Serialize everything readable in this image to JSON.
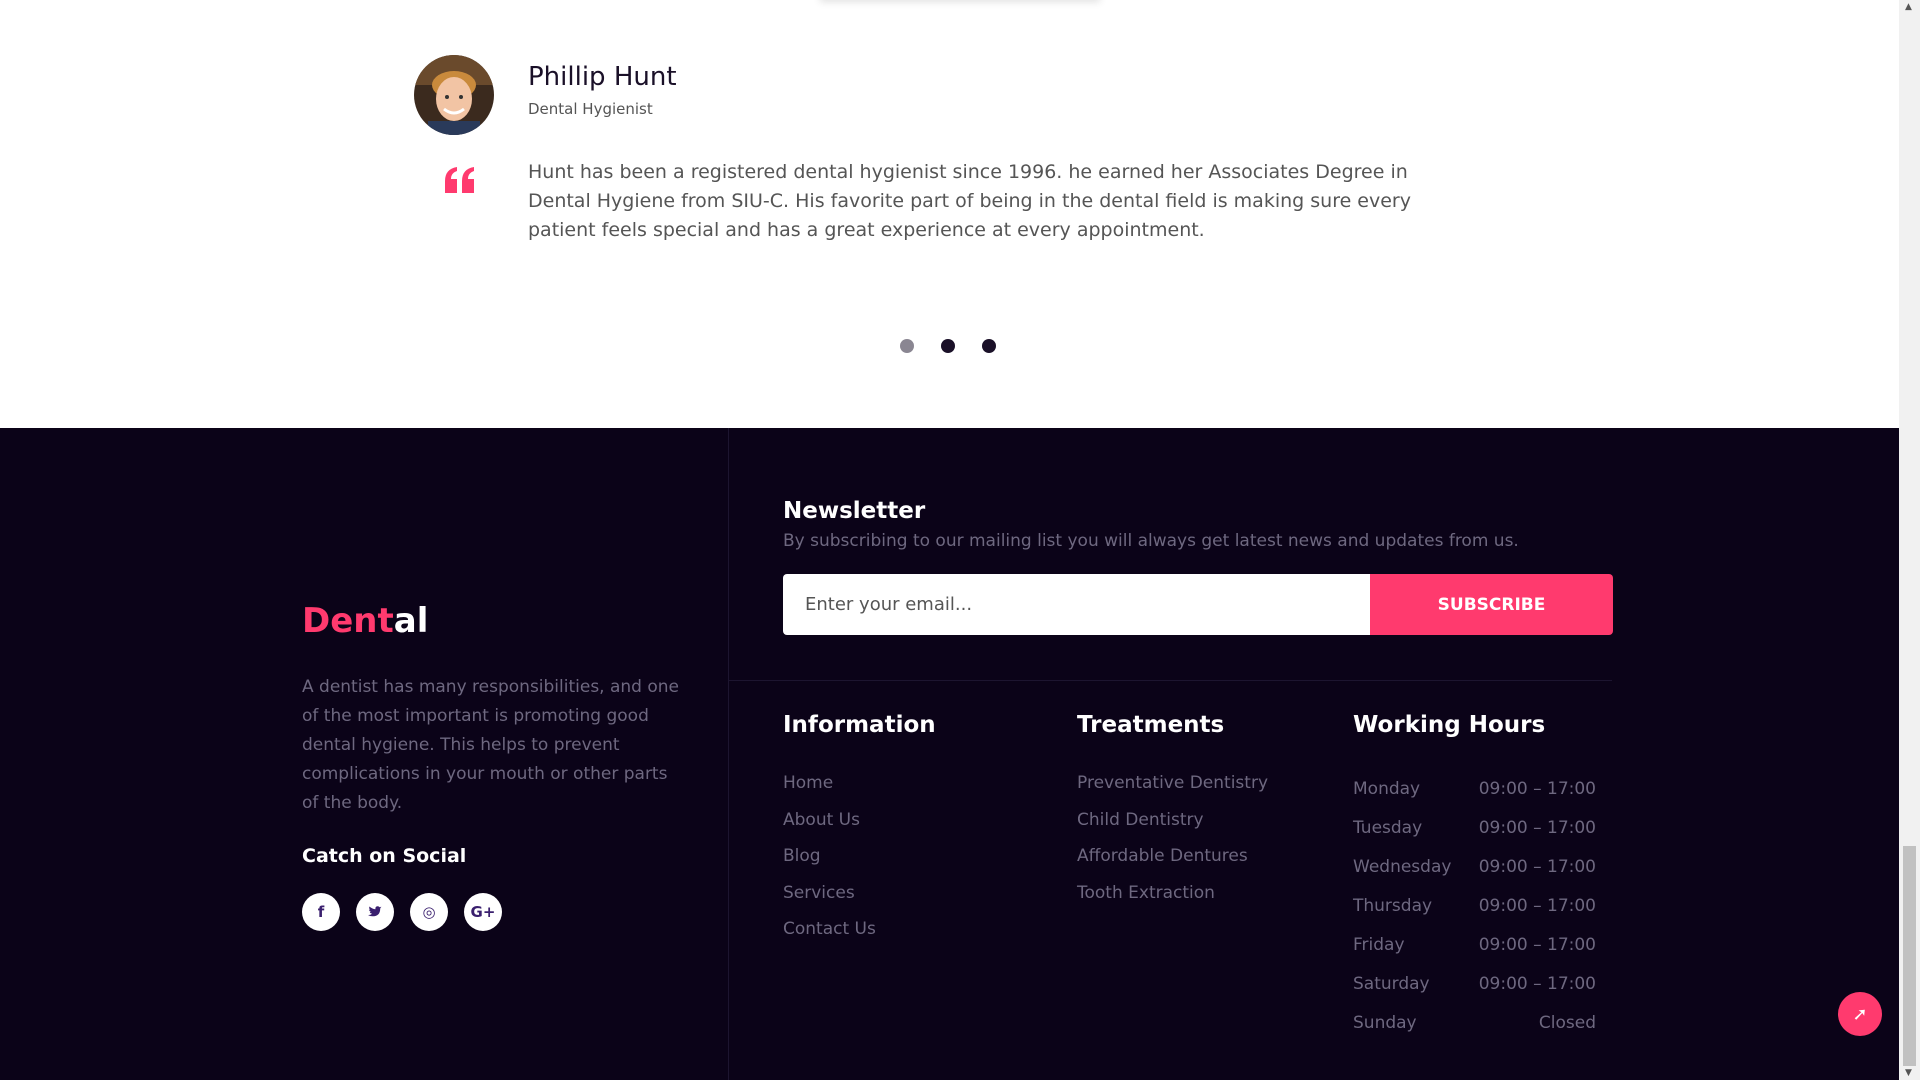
{
  "testimonial": {
    "name": "Phillip Hunt",
    "role": "Dental Hygienist",
    "quote": "Hunt has been a registered dental hygienist since 1996. he earned her Associates Degree in Dental Hygiene from SIU-C. His favorite part of being in the dental field is making sure every patient feels special and has a great experience at every appointment.",
    "active_slide": 1,
    "slide_count": 3
  },
  "footer": {
    "logo_part1": "Dent",
    "logo_part2": "al",
    "about": "A dentist has many responsibilities, and one of the most important is promoting good dental hygiene. This helps to prevent complications in your mouth or other parts of the body.",
    "social_title": "Catch on Social",
    "socials": [
      {
        "icon": "facebook-icon",
        "glyph": "f"
      },
      {
        "icon": "twitter-icon",
        "glyph": "t"
      },
      {
        "icon": "dribbble-icon",
        "glyph": "◎"
      },
      {
        "icon": "google-plus-icon",
        "glyph": "G+"
      }
    ],
    "newsletter": {
      "title": "Newsletter",
      "description": "By subscribing to our mailing list you will always get latest news and updates from us.",
      "placeholder": "Enter your email...",
      "button": "SUBSCRIBE"
    },
    "information": {
      "title": "Information",
      "links": [
        "Home",
        "About Us",
        "Blog",
        "Services",
        "Contact Us"
      ]
    },
    "treatments": {
      "title": "Treatments",
      "links": [
        "Preventative Dentistry",
        "Child Dentistry",
        "Affordable Dentures",
        "Tooth Extraction"
      ]
    },
    "hours": {
      "title": "Working Hours",
      "rows": [
        {
          "day": "Monday",
          "time": "09:00 – 17:00"
        },
        {
          "day": "Tuesday",
          "time": "09:00 – 17:00"
        },
        {
          "day": "Wednesday",
          "time": "09:00 – 17:00"
        },
        {
          "day": "Thursday",
          "time": "09:00 – 17:00"
        },
        {
          "day": "Friday",
          "time": "09:00 – 17:00"
        },
        {
          "day": "Saturday",
          "time": "09:00 – 17:00"
        },
        {
          "day": "Sunday",
          "time": "Closed"
        }
      ]
    },
    "scroll_top_glyph": "➚"
  },
  "colors": {
    "accent": "#ff3a6e",
    "footer_bg": "#0b0318",
    "muted_text": "#6e6880"
  }
}
